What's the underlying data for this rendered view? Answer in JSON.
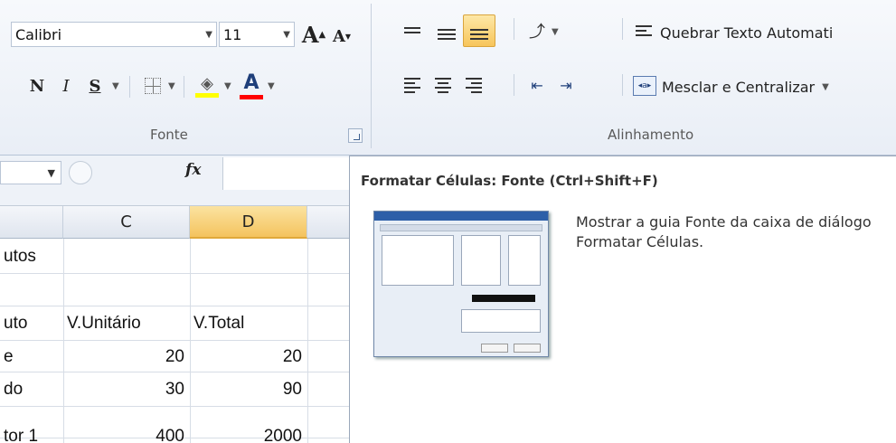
{
  "ribbon": {
    "font_name": "Calibri",
    "font_size": "11",
    "grow_label": "A",
    "shrink_label": "A",
    "bold_label": "N",
    "italic_label": "I",
    "underline_label": "S",
    "font_color_label": "A",
    "wrap_text_label": "Quebrar Texto Automati",
    "merge_center_label": "Mesclar e Centralizar",
    "font_group_label": "Fonte",
    "alignment_group_label": "Alinhamento",
    "colors": {
      "highlight": "#ffff00",
      "font_color": "#ff0000",
      "active_button": "#f7c55b"
    }
  },
  "formula_bar": {
    "fx_label": "fx"
  },
  "grid": {
    "columns": [
      {
        "label": "",
        "selected": false
      },
      {
        "label": "C",
        "selected": false
      },
      {
        "label": "D",
        "selected": true
      }
    ],
    "rows": [
      {
        "b": "utos",
        "c": "",
        "d": ""
      },
      {
        "b": "",
        "c": "",
        "d": ""
      },
      {
        "b": "uto",
        "c": "V.Unitário",
        "d": "V.Total"
      },
      {
        "b": "e",
        "c": "20",
        "d": "20"
      },
      {
        "b": "do",
        "c": "30",
        "d": "90"
      },
      {
        "b": "tor 1",
        "c": "400",
        "d": "2000"
      }
    ]
  },
  "tooltip": {
    "title": "Formatar Células: Fonte (Ctrl+Shift+F)",
    "description": "Mostrar a guia Fonte da caixa de diálogo Formatar Células."
  }
}
